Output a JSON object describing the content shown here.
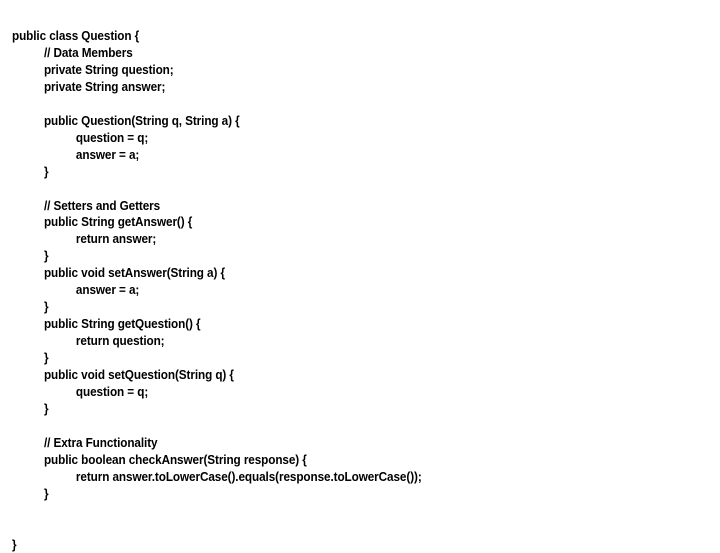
{
  "slide": {
    "background_color": "#ffffff",
    "text_color": "#000000",
    "language": "java",
    "code_lines": [
      {
        "indent": 0,
        "text": "public class Question {"
      },
      {
        "indent": 1,
        "text": "// Data Members"
      },
      {
        "indent": 1,
        "text": "private String question;"
      },
      {
        "indent": 1,
        "text": "private String answer;"
      },
      {
        "indent": 0,
        "text": ""
      },
      {
        "indent": 1,
        "text": "public Question(String q, String a) {"
      },
      {
        "indent": 2,
        "text": "question = q;"
      },
      {
        "indent": 2,
        "text": "answer = a;"
      },
      {
        "indent": 1,
        "text": "}"
      },
      {
        "indent": 0,
        "text": ""
      },
      {
        "indent": 1,
        "text": "// Setters and Getters"
      },
      {
        "indent": 1,
        "text": "public String getAnswer() {"
      },
      {
        "indent": 2,
        "text": "return answer;"
      },
      {
        "indent": 1,
        "text": "}"
      },
      {
        "indent": 1,
        "text": "public void setAnswer(String a) {"
      },
      {
        "indent": 2,
        "text": "answer = a;"
      },
      {
        "indent": 1,
        "text": "}"
      },
      {
        "indent": 1,
        "text": "public String getQuestion() {"
      },
      {
        "indent": 2,
        "text": "return question;"
      },
      {
        "indent": 1,
        "text": "}"
      },
      {
        "indent": 1,
        "text": "public void setQuestion(String q) {"
      },
      {
        "indent": 2,
        "text": "question = q;"
      },
      {
        "indent": 1,
        "text": "}"
      },
      {
        "indent": 0,
        "text": ""
      },
      {
        "indent": 1,
        "text": "// Extra Functionality"
      },
      {
        "indent": 1,
        "text": "public boolean checkAnswer(String response) {"
      },
      {
        "indent": 2,
        "text": "return answer.toLowerCase().equals(response.toLowerCase());"
      },
      {
        "indent": 1,
        "text": "}"
      },
      {
        "indent": 0,
        "text": ""
      },
      {
        "indent": 0,
        "text": ""
      },
      {
        "indent": 0,
        "text": "}"
      }
    ]
  }
}
